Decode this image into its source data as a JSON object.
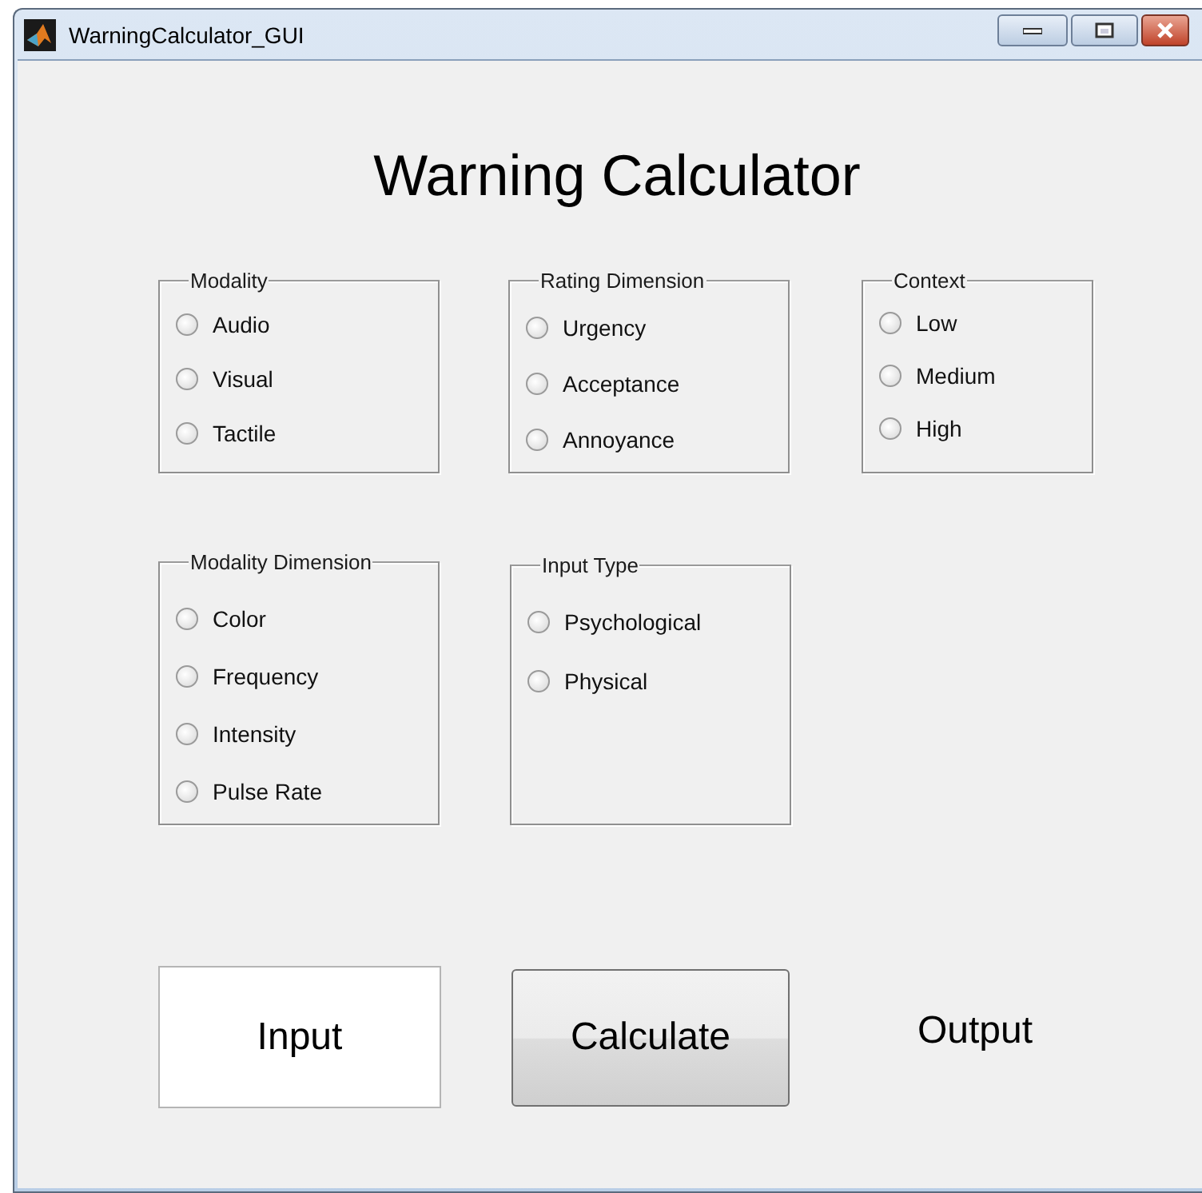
{
  "window": {
    "title": "WarningCalculator_GUI"
  },
  "heading": "Warning Calculator",
  "groups": [
    {
      "title": "Modality",
      "options": [
        {
          "label": "Audio",
          "selected": false
        },
        {
          "label": "Visual",
          "selected": false
        },
        {
          "label": "Tactile",
          "selected": false
        }
      ]
    },
    {
      "title": "Rating Dimension",
      "options": [
        {
          "label": "Urgency",
          "selected": false
        },
        {
          "label": "Acceptance",
          "selected": false
        },
        {
          "label": "Annoyance",
          "selected": false
        }
      ]
    },
    {
      "title": "Context",
      "options": [
        {
          "label": "Low",
          "selected": false
        },
        {
          "label": "Medium",
          "selected": false
        },
        {
          "label": "High",
          "selected": false
        }
      ]
    },
    {
      "title": "Modality Dimension",
      "options": [
        {
          "label": "Color",
          "selected": false
        },
        {
          "label": "Frequency",
          "selected": false
        },
        {
          "label": "Intensity",
          "selected": false
        },
        {
          "label": "Pulse Rate",
          "selected": false
        }
      ]
    },
    {
      "title": "Input Type",
      "options": [
        {
          "label": "Psychological",
          "selected": false
        },
        {
          "label": "Physical",
          "selected": false
        }
      ]
    }
  ],
  "input": {
    "value": "Input"
  },
  "calculate_button": "Calculate",
  "output": "Output"
}
